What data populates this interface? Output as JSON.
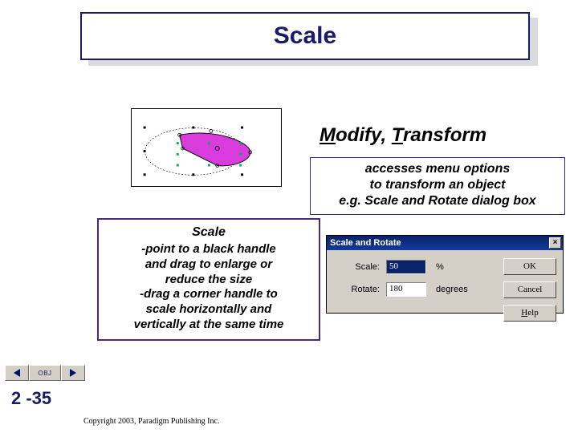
{
  "title": "Scale",
  "menu_path": {
    "modify_initial": "M",
    "modify_rest": "odify, ",
    "transform_initial": "T",
    "transform_rest": "ransform"
  },
  "access_box": {
    "line1": "accesses menu options",
    "line2": "to transform an object",
    "line3": "e.g. Scale and Rotate dialog box"
  },
  "scale_box": {
    "heading": "Scale",
    "line1": "-point to a black handle",
    "line2": "and drag to enlarge or",
    "line3": "reduce the size",
    "line4": "-drag a corner handle to",
    "line5": "scale horizontally and",
    "line6": "vertically at the same time"
  },
  "dialog": {
    "title": "Scale and Rotate",
    "close": "×",
    "scale_label_initial": "S",
    "scale_label_rest": "cale:",
    "scale_value": "50",
    "scale_unit": "%",
    "rotate_label_initial": "R",
    "rotate_label_rest": "otate:",
    "rotate_value": "180",
    "rotate_unit": "degrees",
    "ok": "OK",
    "cancel": "Cancel",
    "help_initial": "H",
    "help_rest": "elp"
  },
  "nav": {
    "obj": "OBJ"
  },
  "page_number": "2 -35",
  "copyright": "Copyright 2003, Paradigm Publishing Inc."
}
